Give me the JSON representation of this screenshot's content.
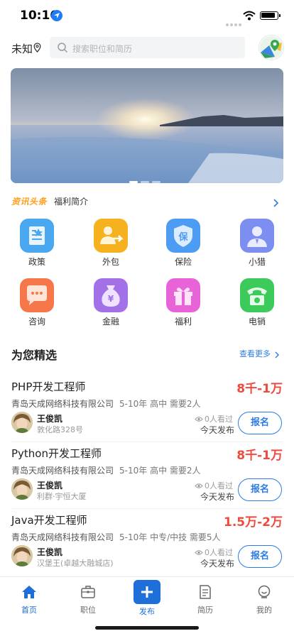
{
  "status": {
    "time": "10:16"
  },
  "header": {
    "city": "未知",
    "search_placeholder": "搜索职位和简历"
  },
  "news": {
    "logo": "资讯头条",
    "text": "福利简介"
  },
  "categories": [
    {
      "label": "政策",
      "icon": "policy-icon",
      "color": "#4aa8f0"
    },
    {
      "label": "外包",
      "icon": "outsource-icon",
      "color": "#f6b11f"
    },
    {
      "label": "保险",
      "icon": "insurance-icon",
      "color": "#4b9cf2"
    },
    {
      "label": "小猎",
      "icon": "headhunter-icon",
      "color": "#7c8ef0"
    },
    {
      "label": "咨询",
      "icon": "consult-icon",
      "color": "#f6784a"
    },
    {
      "label": "金融",
      "icon": "finance-icon",
      "color": "#a271e8"
    },
    {
      "label": "福利",
      "icon": "welfare-icon",
      "color": "#e863d8"
    },
    {
      "label": "电销",
      "icon": "telesales-icon",
      "color": "#3ccb5a"
    }
  ],
  "section": {
    "title": "为您精选",
    "more": "查看更多"
  },
  "jobs": [
    {
      "title": "PHP开发工程师",
      "salary": "8千-1万",
      "company": "青岛天成网络科技有限公司",
      "req": "5-10年 高中 需要2人",
      "name": "王俊凯",
      "addr": "敦化路328号",
      "views": "0人看过",
      "date": "今天发布",
      "button": "报名"
    },
    {
      "title": "Python开发工程师",
      "salary": "8千-1万",
      "company": "青岛天成网络科技有限公司",
      "req": "5-10年 高中 需要2人",
      "name": "王俊凯",
      "addr": "利群·宇恒大厦",
      "views": "0人看过",
      "date": "今天发布",
      "button": "报名"
    },
    {
      "title": "Java开发工程师",
      "salary": "1.5万-2万",
      "company": "青岛天成网络科技有限公司",
      "req": "5-10年 中专/中技 需要5人",
      "name": "王俊凯",
      "addr": "汉堡王(卓越大融城店)",
      "views": "0人看过",
      "date": "今天发布",
      "button": "报名"
    }
  ],
  "tabs": {
    "home": "首页",
    "jobs": "职位",
    "publish": "发布",
    "resume": "简历",
    "mine": "我的"
  },
  "colors": {
    "accent": "#1e6fd9",
    "salary": "#f04a3d"
  }
}
